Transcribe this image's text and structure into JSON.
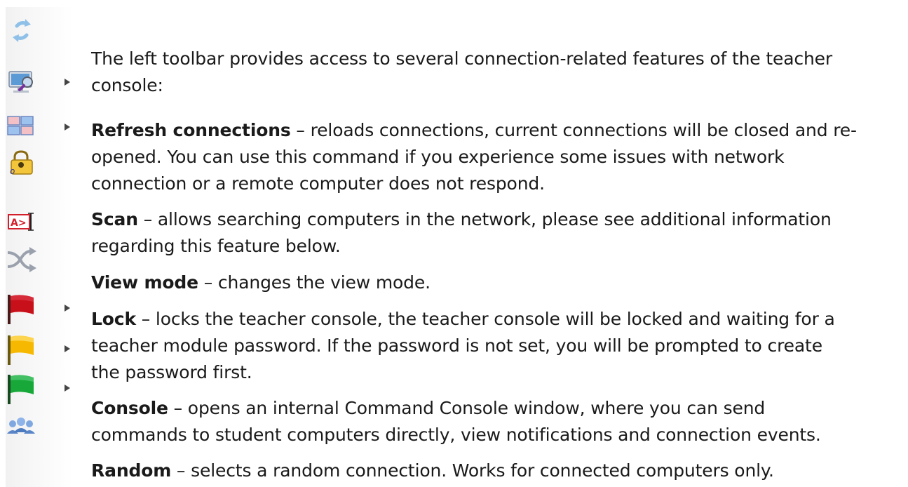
{
  "toolbar": {
    "icons": [
      {
        "name": "refresh-connections-icon",
        "has_menu": false
      },
      {
        "name": "scan-icon",
        "has_menu": true
      },
      {
        "name": "view-mode-icon",
        "has_menu": true
      },
      {
        "name": "lock-icon",
        "has_menu": false
      },
      {
        "name": "console-icon",
        "has_menu": false
      },
      {
        "name": "random-icon",
        "has_menu": false
      },
      {
        "name": "red-flag-icon",
        "has_menu": true
      },
      {
        "name": "yellow-flag-icon",
        "has_menu": true
      },
      {
        "name": "green-flag-icon",
        "has_menu": true
      },
      {
        "name": "users-group-icon",
        "has_menu": false
      }
    ],
    "colors": {
      "red_flag": "#c8101a",
      "yellow_flag": "#f6b800",
      "green_flag": "#18a83a",
      "refresh": "#7fb4e0"
    }
  },
  "intro": {
    "line1": "The left toolbar provides access to several connection-related features of the teacher",
    "line2": "console:"
  },
  "items": [
    {
      "term": "Refresh connections",
      "lines": [
        " – reloads connections, current connections will be closed and re-",
        "opened. You can use this command if you experience some issues with network",
        "connection or a remote computer does not respond."
      ]
    },
    {
      "term": "Scan",
      "lines": [
        " – allows searching computers in the network, please see additional information",
        "regarding this feature below."
      ]
    },
    {
      "term": "View mode",
      "lines": [
        " – changes the view mode."
      ]
    },
    {
      "term": "Lock",
      "lines": [
        " – locks the teacher console, the teacher console will be locked and waiting for a",
        "teacher module password. If the password is not set, you will be prompted to create",
        "the password first."
      ]
    },
    {
      "term": "Console",
      "lines": [
        " – opens an internal Command Console window, where you can send",
        "commands to student computers directly, view notifications and connection events."
      ]
    },
    {
      "term": "Random",
      "lines": [
        " – selects a random connection. Works for connected computers only."
      ]
    }
  ]
}
